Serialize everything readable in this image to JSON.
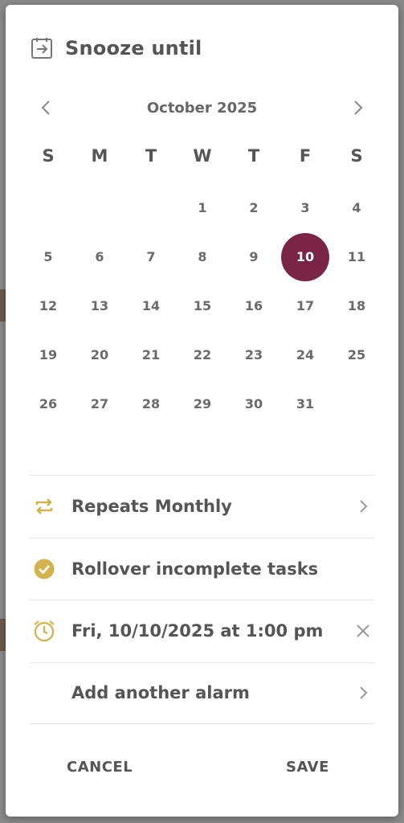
{
  "dialog": {
    "title": "Snooze until",
    "title_icon": "snooze-arrow-icon"
  },
  "calendar": {
    "month_label": "October 2025",
    "prev_icon": "chevron-left-icon",
    "next_icon": "chevron-right-icon",
    "weekdays": [
      "S",
      "M",
      "T",
      "W",
      "T",
      "F",
      "S"
    ],
    "leading_blank_days": 3,
    "days": [
      "1",
      "2",
      "3",
      "4",
      "5",
      "6",
      "7",
      "8",
      "9",
      "10",
      "11",
      "12",
      "13",
      "14",
      "15",
      "16",
      "17",
      "18",
      "19",
      "20",
      "21",
      "22",
      "23",
      "24",
      "25",
      "26",
      "27",
      "28",
      "29",
      "30",
      "31"
    ],
    "selected_day": "10",
    "selected_color": "#7a2446"
  },
  "options": {
    "repeat": {
      "label": "Repeats Monthly",
      "icon": "repeat-icon"
    },
    "rollover": {
      "label": "Rollover incomplete tasks",
      "icon": "check-circle-icon"
    },
    "alarm": {
      "label": "Fri, 10/10/2025 at 1:00 pm",
      "icon": "alarm-clock-icon"
    },
    "add_alarm": {
      "label": "Add another alarm"
    },
    "accent_color": "#d4b24c"
  },
  "actions": {
    "cancel_label": "CANCEL",
    "save_label": "SAVE"
  }
}
